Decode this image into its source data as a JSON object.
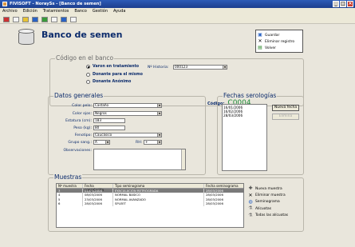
{
  "window": {
    "title": "FIVISOFT - NoraySs - [Banco de semen]"
  },
  "menu": [
    "Archivo",
    "Edición",
    "Tratamientos",
    "Banco",
    "Gestión",
    "Ayuda"
  ],
  "page": {
    "title": "Banco de semen"
  },
  "actions": {
    "save": "Guardar",
    "delete": "Eliminar registro",
    "back": "Volver"
  },
  "bank": {
    "group_title": "Código en el banco",
    "radio_1": "Varon en tratamiento",
    "radio_2": "Donante para el mismo",
    "radio_3": "Donante Anónimo",
    "history_label": "Nº Historia:",
    "history_value": "000123",
    "codigo_label": "Código:",
    "codigo_value": "C0004"
  },
  "general": {
    "group_title": "Datos generales",
    "hair_label": "Color pelo:",
    "hair_value": "Castaño",
    "eyes_label": "Color ojos:",
    "eyes_value": "Negros",
    "height_label": "Estatura (cm):",
    "height_value": "183",
    "weight_label": "Peso (kg):",
    "weight_value": "80",
    "phenotype_label": "Fenotipo:",
    "phenotype_value": "Caucásico",
    "blood_label": "Grupo sang.:",
    "blood_value": "A",
    "rh_label": "RH:",
    "rh_value": "+",
    "obs_label": "Observaciones:"
  },
  "serology": {
    "group_title": "Fechas serologías",
    "dates": [
      "16/01/2006",
      "16/02/2006",
      "28/03/2006"
    ],
    "new_button": "Nueva fecha",
    "delete_button": "Elimina"
  },
  "samples": {
    "group_title": "Muestras",
    "columns": [
      "Nº muestra",
      "Fecha congelación",
      "Tipo seminograma",
      "Fecha seminograma"
    ],
    "rows": [
      [
        "3",
        "01/03/2006",
        "EYACULACIÓN RETRÓGRADA",
        "28/03/2006"
      ],
      [
        "4",
        "08/03/2006",
        "NORMAL BASICO",
        "28/03/2006"
      ],
      [
        "5",
        "23/03/2006",
        "NORMAL AVANZADO",
        "28/03/2006"
      ],
      [
        "6",
        "28/03/2006",
        "SPLEET",
        "28/03/2006"
      ]
    ],
    "actions": [
      "Nueva muestra",
      "Eliminar muestra",
      "Seminograma",
      "Alícuotas",
      "Todas las alícuotas"
    ]
  }
}
